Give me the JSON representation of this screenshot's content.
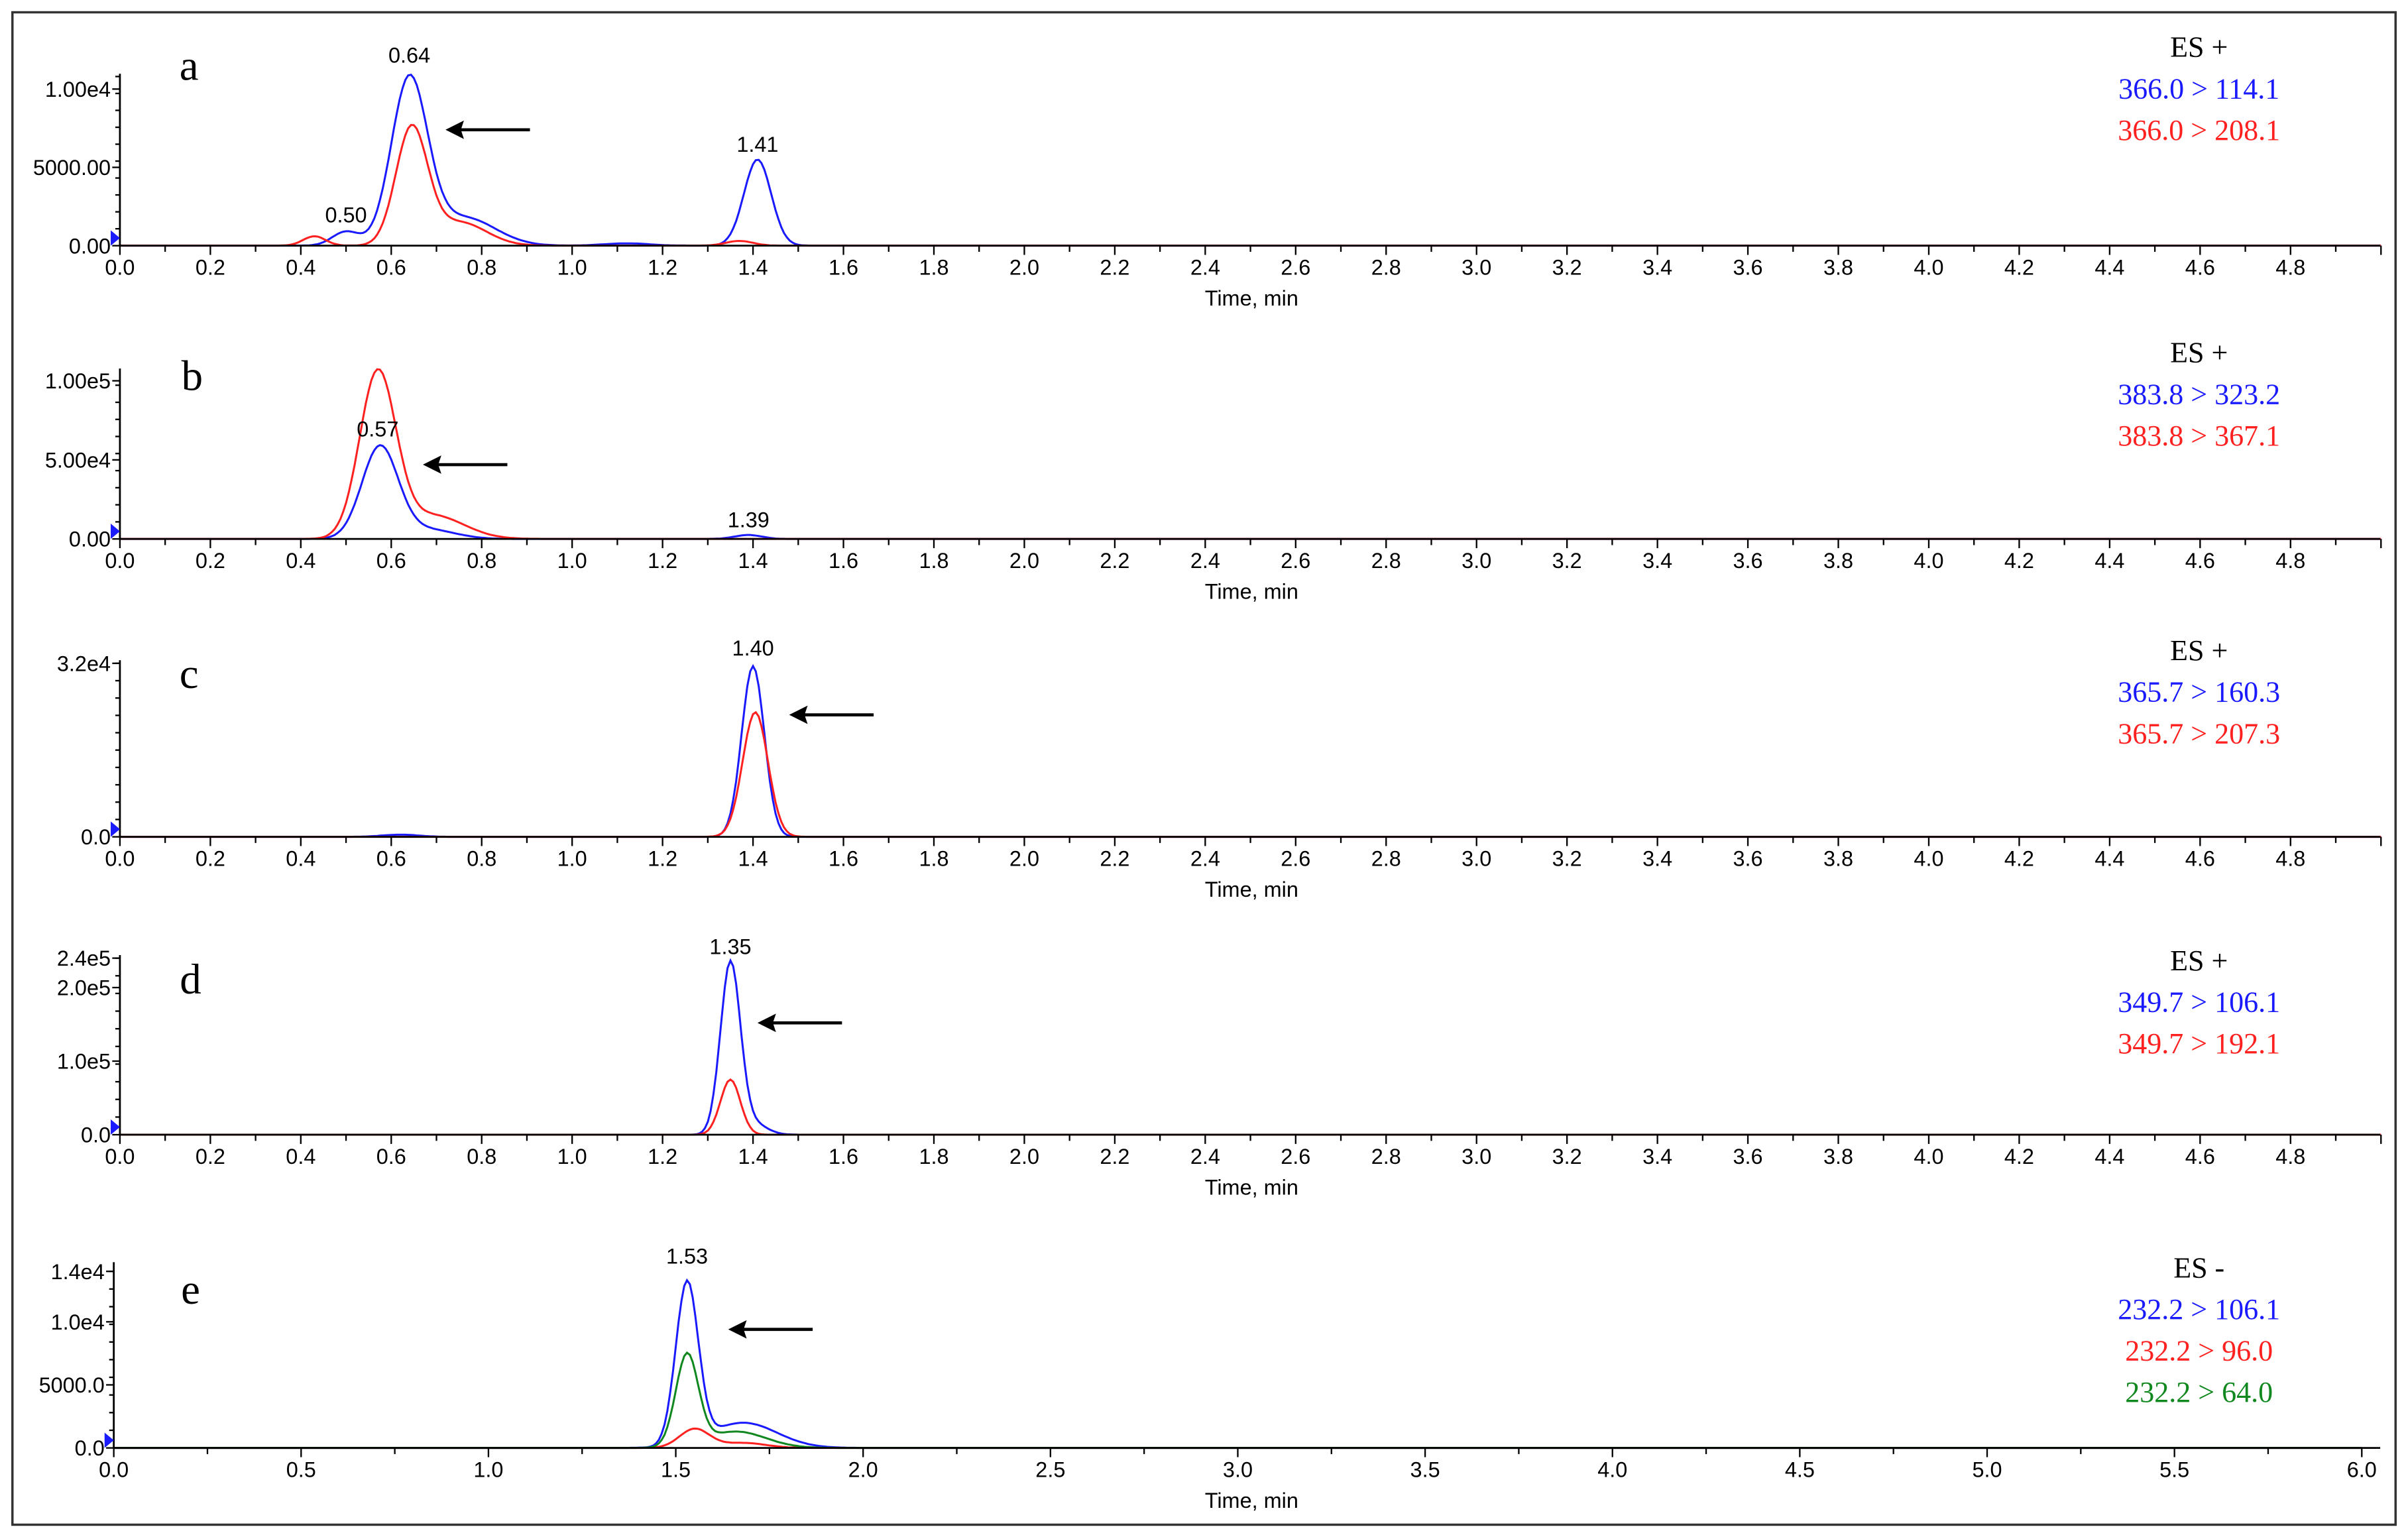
{
  "chart_data": [
    {
      "type": "line",
      "panel": "a",
      "mode": "ES +",
      "xlabel": "Time, min",
      "xlim": [
        0,
        5
      ],
      "x_ticks": [
        "0.0",
        "0.2",
        "0.4",
        "0.6",
        "0.8",
        "1.0",
        "1.2",
        "1.4",
        "1.6",
        "1.8",
        "2.0",
        "2.2",
        "2.4",
        "2.6",
        "2.8",
        "3.0",
        "3.2",
        "3.4",
        "3.6",
        "3.8",
        "4.0",
        "4.2",
        "4.4",
        "4.6",
        "4.8"
      ],
      "x_tick_step": 0.2,
      "y_ticks": [
        {
          "value": 0,
          "label": "0.00"
        },
        {
          "value": 5000,
          "label": "5000.00"
        },
        {
          "value": 10000,
          "label": "1.00e4"
        }
      ],
      "ylim": [
        0,
        10800
      ],
      "peak_labels": [
        {
          "time": 0.5,
          "label": "0.50",
          "value": 1000
        },
        {
          "time": 0.64,
          "label": "0.64",
          "value": 11200
        },
        {
          "time": 1.41,
          "label": "1.41",
          "value": 5500
        }
      ],
      "arrow_time": 0.72,
      "arrow_value": 7400,
      "series": [
        {
          "name": "366.0 > 114.1",
          "color": "#1a1aff",
          "peaks": [
            [
              0.5,
              900,
              0.03
            ],
            [
              0.64,
              10500,
              0.04
            ],
            [
              0.76,
              1800,
              0.07
            ],
            [
              1.41,
              5500,
              0.03
            ],
            [
              1.12,
              150,
              0.05
            ]
          ]
        },
        {
          "name": "366.0 > 208.1",
          "color": "#ff2020",
          "peaks": [
            [
              0.43,
              600,
              0.025
            ],
            [
              0.645,
              7400,
              0.035
            ],
            [
              0.75,
              1500,
              0.06
            ],
            [
              1.37,
              300,
              0.03
            ]
          ]
        }
      ]
    },
    {
      "type": "line",
      "panel": "b",
      "mode": "ES +",
      "xlabel": "Time, min",
      "xlim": [
        0,
        5
      ],
      "x_ticks": [
        "0.0",
        "0.2",
        "0.4",
        "0.6",
        "0.8",
        "1.0",
        "1.2",
        "1.4",
        "1.6",
        "1.8",
        "2.0",
        "2.2",
        "2.4",
        "2.6",
        "2.8",
        "3.0",
        "3.2",
        "3.4",
        "3.6",
        "3.8",
        "4.0",
        "4.2",
        "4.4",
        "4.6",
        "4.8"
      ],
      "x_tick_step": 0.2,
      "y_ticks": [
        {
          "value": 0,
          "label": "0.00"
        },
        {
          "value": 50000,
          "label": "5.00e4"
        },
        {
          "value": 100000,
          "label": "1.00e5"
        }
      ],
      "ylim": [
        0,
        108000
      ],
      "peak_labels": [
        {
          "time": 0.57,
          "label": "0.57",
          "value": 60000
        },
        {
          "time": 1.39,
          "label": "1.39",
          "value": 2500
        }
      ],
      "arrow_time": 0.67,
      "arrow_value": 47000,
      "series": [
        {
          "name": "383.8 > 323.2",
          "color": "#1a1aff",
          "peaks": [
            [
              0.575,
              58000,
              0.04
            ],
            [
              0.68,
              6000,
              0.06
            ],
            [
              1.39,
              2500,
              0.03
            ]
          ]
        },
        {
          "name": "383.8 > 367.1",
          "color": "#ff2020",
          "peaks": [
            [
              0.57,
              104000,
              0.04
            ],
            [
              0.69,
              15000,
              0.07
            ]
          ]
        }
      ]
    },
    {
      "type": "line",
      "panel": "c",
      "mode": "ES +",
      "xlabel": "Time, min",
      "xlim": [
        0,
        5
      ],
      "x_ticks": [
        "0.0",
        "0.2",
        "0.4",
        "0.6",
        "0.8",
        "1.0",
        "1.2",
        "1.4",
        "1.6",
        "1.8",
        "2.0",
        "2.2",
        "2.4",
        "2.6",
        "2.8",
        "3.0",
        "3.2",
        "3.4",
        "3.6",
        "3.8",
        "4.0",
        "4.2",
        "4.4",
        "4.6",
        "4.8"
      ],
      "x_tick_step": 0.2,
      "y_ticks": [
        {
          "value": 0,
          "label": "0.0"
        },
        {
          "value": 32000,
          "label": "3.2e4"
        }
      ],
      "ylim": [
        0,
        32000
      ],
      "peak_labels": [
        {
          "time": 1.4,
          "label": "1.40",
          "value": 32000
        }
      ],
      "arrow_time": 1.48,
      "arrow_value": 22500,
      "series": [
        {
          "name": "365.7 > 160.3",
          "color": "#1a1aff",
          "peaks": [
            [
              1.4,
              31500,
              0.025
            ],
            [
              0.62,
              400,
              0.04
            ]
          ]
        },
        {
          "name": "365.7 > 207.3",
          "color": "#ff2020",
          "peaks": [
            [
              1.405,
              23000,
              0.028
            ]
          ]
        }
      ]
    },
    {
      "type": "line",
      "panel": "d",
      "mode": "ES +",
      "xlabel": "Time, min",
      "xlim": [
        0,
        5
      ],
      "x_ticks": [
        "0.0",
        "0.2",
        "0.4",
        "0.6",
        "0.8",
        "1.0",
        "1.2",
        "1.4",
        "1.6",
        "1.8",
        "2.0",
        "2.2",
        "2.4",
        "2.6",
        "2.8",
        "3.0",
        "3.2",
        "3.4",
        "3.6",
        "3.8",
        "4.0",
        "4.2",
        "4.4",
        "4.6",
        "4.8"
      ],
      "x_tick_step": 0.2,
      "y_ticks": [
        {
          "value": 0,
          "label": "0.0"
        },
        {
          "value": 100000,
          "label": "1.0e5"
        },
        {
          "value": 200000,
          "label": "2.0e5"
        },
        {
          "value": 240000,
          "label": "2.4e5"
        }
      ],
      "ylim": [
        0,
        240000
      ],
      "peak_labels": [
        {
          "time": 1.35,
          "label": "1.35",
          "value": 235000
        }
      ],
      "arrow_time": 1.41,
      "arrow_value": 152000,
      "series": [
        {
          "name": "349.7 > 106.1",
          "color": "#1a1aff",
          "peaks": [
            [
              1.35,
              233000,
              0.022
            ],
            [
              1.4,
              15000,
              0.03
            ]
          ]
        },
        {
          "name": "349.7 > 192.1",
          "color": "#ff2020",
          "peaks": [
            [
              1.35,
              75000,
              0.022
            ]
          ]
        }
      ]
    },
    {
      "type": "line",
      "panel": "e",
      "mode": "ES -",
      "xlabel": "Time, min",
      "xlim": [
        0,
        6
      ],
      "x_ticks": [
        "0.0",
        "0.5",
        "1.0",
        "1.5",
        "2.0",
        "2.5",
        "3.0",
        "3.5",
        "4.0",
        "4.5",
        "5.0",
        "5.5",
        "6.0"
      ],
      "x_tick_step": 0.5,
      "y_ticks": [
        {
          "value": 0,
          "label": "0.0"
        },
        {
          "value": 5000,
          "label": "5000.0"
        },
        {
          "value": 10000,
          "label": "1.0e4"
        },
        {
          "value": 14000,
          "label": "1.4e4"
        }
      ],
      "ylim": [
        0,
        14000
      ],
      "peak_labels": [
        {
          "time": 1.53,
          "label": "1.53",
          "value": 14000
        }
      ],
      "arrow_time": 1.64,
      "arrow_value": 9400,
      "series": [
        {
          "name": "232.2 > 106.1",
          "color": "#1a1aff",
          "peaks": [
            [
              1.53,
              12800,
              0.03
            ],
            [
              1.68,
              2000,
              0.09
            ]
          ]
        },
        {
          "name": "232.2 > 96.0",
          "color": "#ff2020",
          "peaks": [
            [
              1.55,
              1500,
              0.04
            ],
            [
              1.68,
              400,
              0.06
            ]
          ]
        },
        {
          "name": "232.2 > 64.0",
          "color": "#11881f",
          "peaks": [
            [
              1.53,
              7200,
              0.03
            ],
            [
              1.66,
              1300,
              0.08
            ]
          ]
        }
      ]
    }
  ]
}
